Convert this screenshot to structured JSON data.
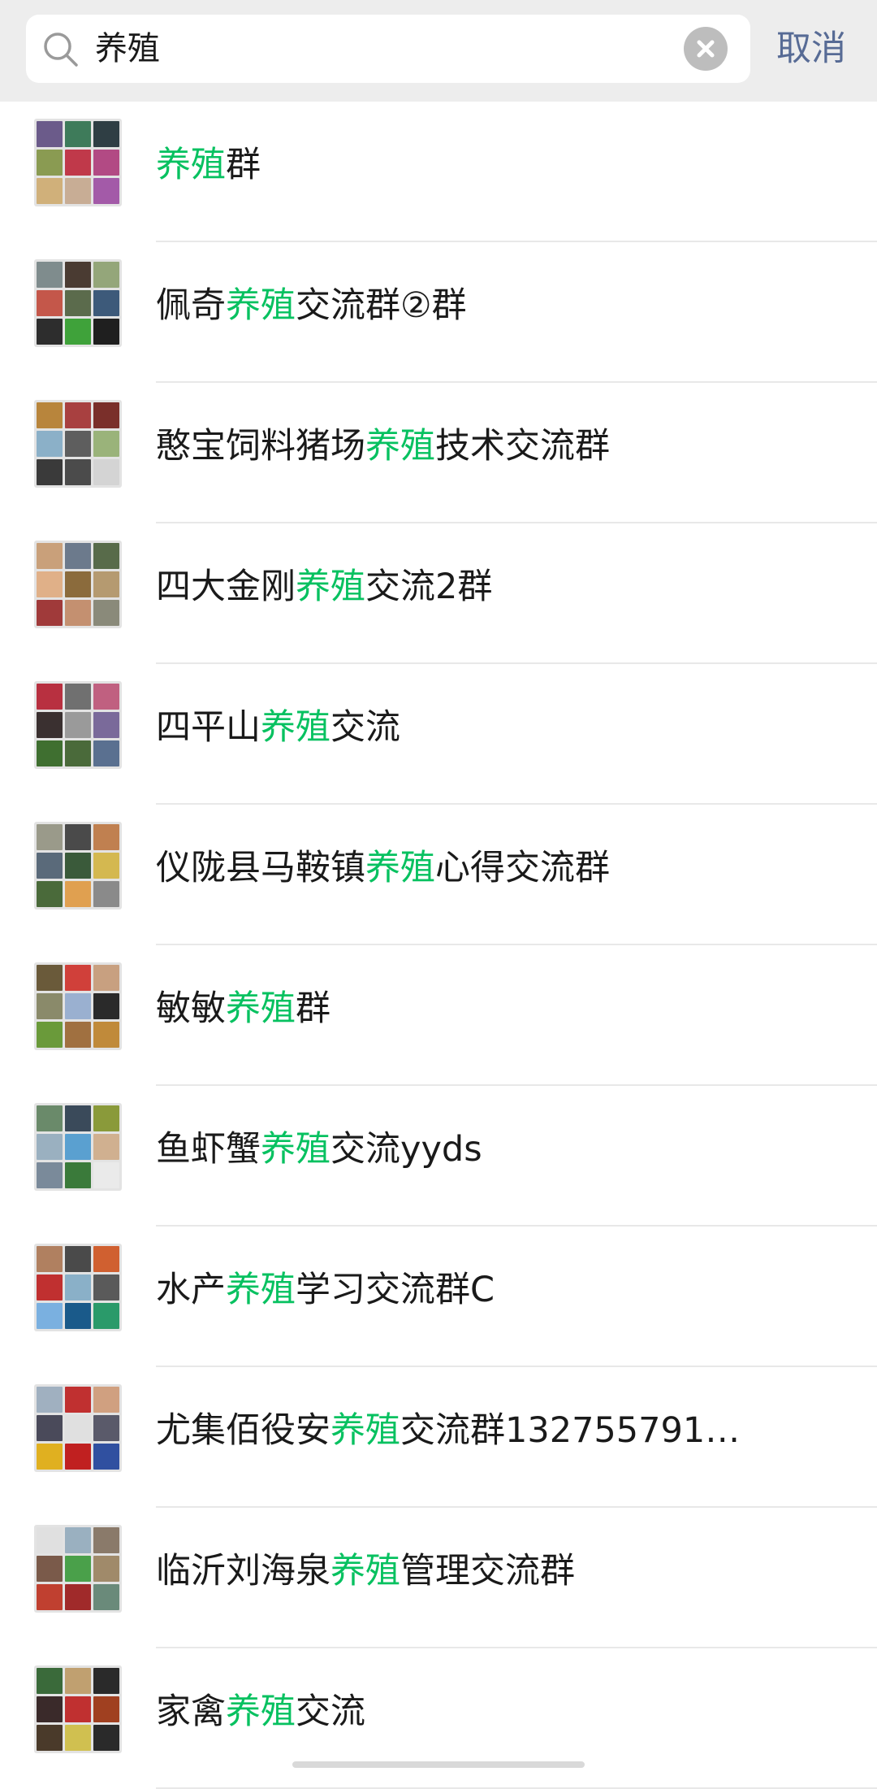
{
  "search": {
    "query": "养殖",
    "cancel_label": "取消"
  },
  "highlight_color": "#07c160",
  "results": [
    {
      "pre": "",
      "hl": "养殖",
      "post": "群",
      "tiles": [
        "#6b5b8a",
        "#3e7b5a",
        "#2f3e44",
        "#8a9b52",
        "#c0394a",
        "#b24a84",
        "#d0b07a",
        "#c8ad95",
        "#a35aa8"
      ]
    },
    {
      "pre": "佩奇",
      "hl": "养殖",
      "post": "交流群②群",
      "tiles": [
        "#7f8c8d",
        "#4a3b32",
        "#94a67a",
        "#c4574a",
        "#5b6b4c",
        "#3d5a7a",
        "#2d2d2d",
        "#3fa23a",
        "#1f1f1f"
      ]
    },
    {
      "pre": "憨宝饲料猪场",
      "hl": "养殖",
      "post": "技术交流群",
      "tiles": [
        "#b8853c",
        "#a84040",
        "#7a2f2a",
        "#8bb0c8",
        "#5e5e5e",
        "#9ab37a",
        "#3a3a3a",
        "#4b4b4b",
        "#d4d4d4"
      ]
    },
    {
      "pre": "四大金刚",
      "hl": "养殖",
      "post": "交流2群",
      "tiles": [
        "#c9a07a",
        "#6c7a8c",
        "#586b4a",
        "#e0b088",
        "#8b6b3c",
        "#b59a70",
        "#a03a3a",
        "#c49070",
        "#8a8a7a"
      ]
    },
    {
      "pre": "四平山",
      "hl": "养殖",
      "post": "交流",
      "tiles": [
        "#b83040",
        "#707070",
        "#c06080",
        "#3a3030",
        "#9a9a9a",
        "#7a6a9a",
        "#3f6f30",
        "#4a6a3a",
        "#5a7090"
      ]
    },
    {
      "pre": "仪陇县马鞍镇",
      "hl": "养殖",
      "post": "心得交流群",
      "tiles": [
        "#9a9a8a",
        "#4a4a4a",
        "#c08050",
        "#5a6a7a",
        "#3a5a3a",
        "#d4b850",
        "#4a6a3a",
        "#e0a050",
        "#8a8a8a"
      ]
    },
    {
      "pre": "敏敏",
      "hl": "养殖",
      "post": "群",
      "tiles": [
        "#6a5a3a",
        "#d0403a",
        "#c8a080",
        "#8a8a6a",
        "#9ab0d0",
        "#2a2a2a",
        "#6a9a3a",
        "#a07040",
        "#c08a3a"
      ]
    },
    {
      "pre": "鱼虾蟹",
      "hl": "养殖",
      "post": "交流yyds",
      "tiles": [
        "#6a8a6a",
        "#3a4a5a",
        "#8a9a3a",
        "#9ab0c0",
        "#5aa0d0",
        "#d0b090",
        "#7a8a9a",
        "#3a7a3a",
        "#eaeaea"
      ]
    },
    {
      "pre": "水产",
      "hl": "养殖",
      "post": "学习交流群C",
      "tiles": [
        "#b08060",
        "#4a4a4a",
        "#d06030",
        "#c03030",
        "#8ab0c8",
        "#5a5a5a",
        "#7ab0e0",
        "#1a5a8a",
        "#2a9a6a"
      ]
    },
    {
      "pre": "尤集佰役安",
      "hl": "养殖",
      "post": "交流群132755791…",
      "tiles": [
        "#a0b0c0",
        "#c03030",
        "#d0a080",
        "#4a4a5a",
        "#e0e0e0",
        "#5a5a6a",
        "#e0b020",
        "#c02020",
        "#3050a0"
      ]
    },
    {
      "pre": "临沂刘海泉",
      "hl": "养殖",
      "post": "管理交流群",
      "tiles": [
        "#e0e0e0",
        "#9ab0c0",
        "#8a7a6a",
        "#7a5a4a",
        "#4aa04a",
        "#a08a6a",
        "#c04030",
        "#a02a2a",
        "#6a8a7a"
      ]
    },
    {
      "pre": "家禽",
      "hl": "养殖",
      "post": "交流",
      "tiles": [
        "#3a6a3a",
        "#c0a070",
        "#2a2a2a",
        "#3a2a2a",
        "#c03030",
        "#a04020",
        "#4a3a2a",
        "#d0c050",
        "#2a2a2a"
      ]
    }
  ]
}
